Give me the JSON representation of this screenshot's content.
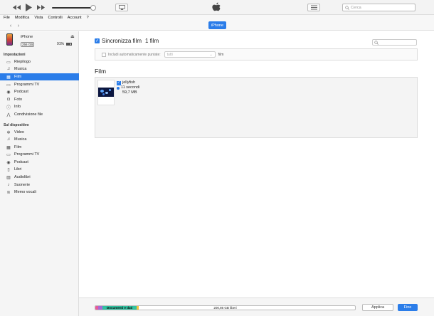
{
  "toolbar": {
    "search_placeholder": "Cerca",
    "volume_level": 0.9
  },
  "menubar": {
    "items": [
      "File",
      "Modifica",
      "Vista",
      "Controlli",
      "Account",
      "?"
    ]
  },
  "navbar": {
    "device_button": "iPhone"
  },
  "sidebar": {
    "device": {
      "name": "iPhone",
      "capacity": "256 GB",
      "battery": "91%",
      "battery_level": 0.91
    },
    "settings_header": "Impostazioni",
    "settings_items": [
      {
        "label": "Riepilogo",
        "icon": "summary-icon"
      },
      {
        "label": "Musica",
        "icon": "music-note-icon"
      },
      {
        "label": "Film",
        "icon": "film-icon",
        "active": true
      },
      {
        "label": "Programmi TV",
        "icon": "tv-icon"
      },
      {
        "label": "Podcast",
        "icon": "podcast-icon"
      },
      {
        "label": "Foto",
        "icon": "camera-icon"
      },
      {
        "label": "Info",
        "icon": "info-icon"
      },
      {
        "label": "Condivisione file",
        "icon": "file-sharing-icon"
      }
    ],
    "ondevice_header": "Sul dispositivo",
    "ondevice_items": [
      {
        "label": "Video",
        "icon": "gear-video-icon"
      },
      {
        "label": "Musica",
        "icon": "music-note-icon"
      },
      {
        "label": "Film",
        "icon": "film-icon"
      },
      {
        "label": "Programmi TV",
        "icon": "tv-icon"
      },
      {
        "label": "Podcast",
        "icon": "podcast-icon"
      },
      {
        "label": "Libri",
        "icon": "book-icon"
      },
      {
        "label": "Audiolibri",
        "icon": "audiobook-icon"
      },
      {
        "label": "Suonerie",
        "icon": "bell-icon"
      },
      {
        "label": "Memo vocali",
        "icon": "voice-memo-icon"
      }
    ]
  },
  "main": {
    "sync_label": "Sincronizza film",
    "sync_count": "1 film",
    "auto_include_label": "Includi automaticamente puntate:",
    "auto_include_select": "tutti",
    "auto_include_suffix": "film",
    "section_title": "Film",
    "movies": [
      {
        "title": "jellyfish",
        "duration": "11 secondi",
        "size": "59,7 MB"
      }
    ]
  },
  "bottom": {
    "storage_label": "Documenti e dati",
    "free_label": "200,86 GB liberi",
    "apply_button": "Applica",
    "done_button": "Fine",
    "colors": {
      "segment_1": "#e85b9a",
      "segment_2": "#a56ad6",
      "segment_3": "#2fc2a1",
      "segment_4": "#f3c13f",
      "accent": "#2b7de9"
    }
  }
}
